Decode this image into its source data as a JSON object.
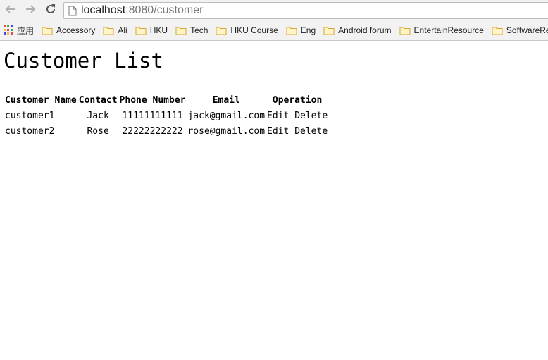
{
  "browser": {
    "url_host": "localhost",
    "url_rest": ":8080/customer",
    "bookmarks": [
      {
        "label": "应用",
        "icon": "apps-grid-icon"
      },
      {
        "label": "Accessory",
        "icon": "folder-icon"
      },
      {
        "label": "Ali",
        "icon": "folder-icon"
      },
      {
        "label": "HKU",
        "icon": "folder-icon"
      },
      {
        "label": "Tech",
        "icon": "folder-icon"
      },
      {
        "label": "HKU Course",
        "icon": "folder-icon"
      },
      {
        "label": "Eng",
        "icon": "folder-icon"
      },
      {
        "label": "Android forum",
        "icon": "folder-icon"
      },
      {
        "label": "EntertainResource",
        "icon": "folder-icon"
      },
      {
        "label": "SoftwareRe",
        "icon": "folder-icon"
      }
    ]
  },
  "page": {
    "title": "Customer List",
    "table": {
      "headers": [
        "Customer Name",
        "Contact",
        "Phone Number",
        "Email",
        "Operation"
      ],
      "rows": [
        {
          "name": "customer1",
          "contact": "Jack",
          "phone": "11111111111",
          "email": "jack@gmail.com",
          "edit": "Edit",
          "delete": "Delete"
        },
        {
          "name": "customer2",
          "contact": "Rose",
          "phone": "22222222222",
          "email": "rose@gmail.com",
          "edit": "Edit",
          "delete": "Delete"
        }
      ]
    }
  },
  "colors": {
    "chrome_bg": "#f2f2f2",
    "folder": "#e8b84a"
  }
}
